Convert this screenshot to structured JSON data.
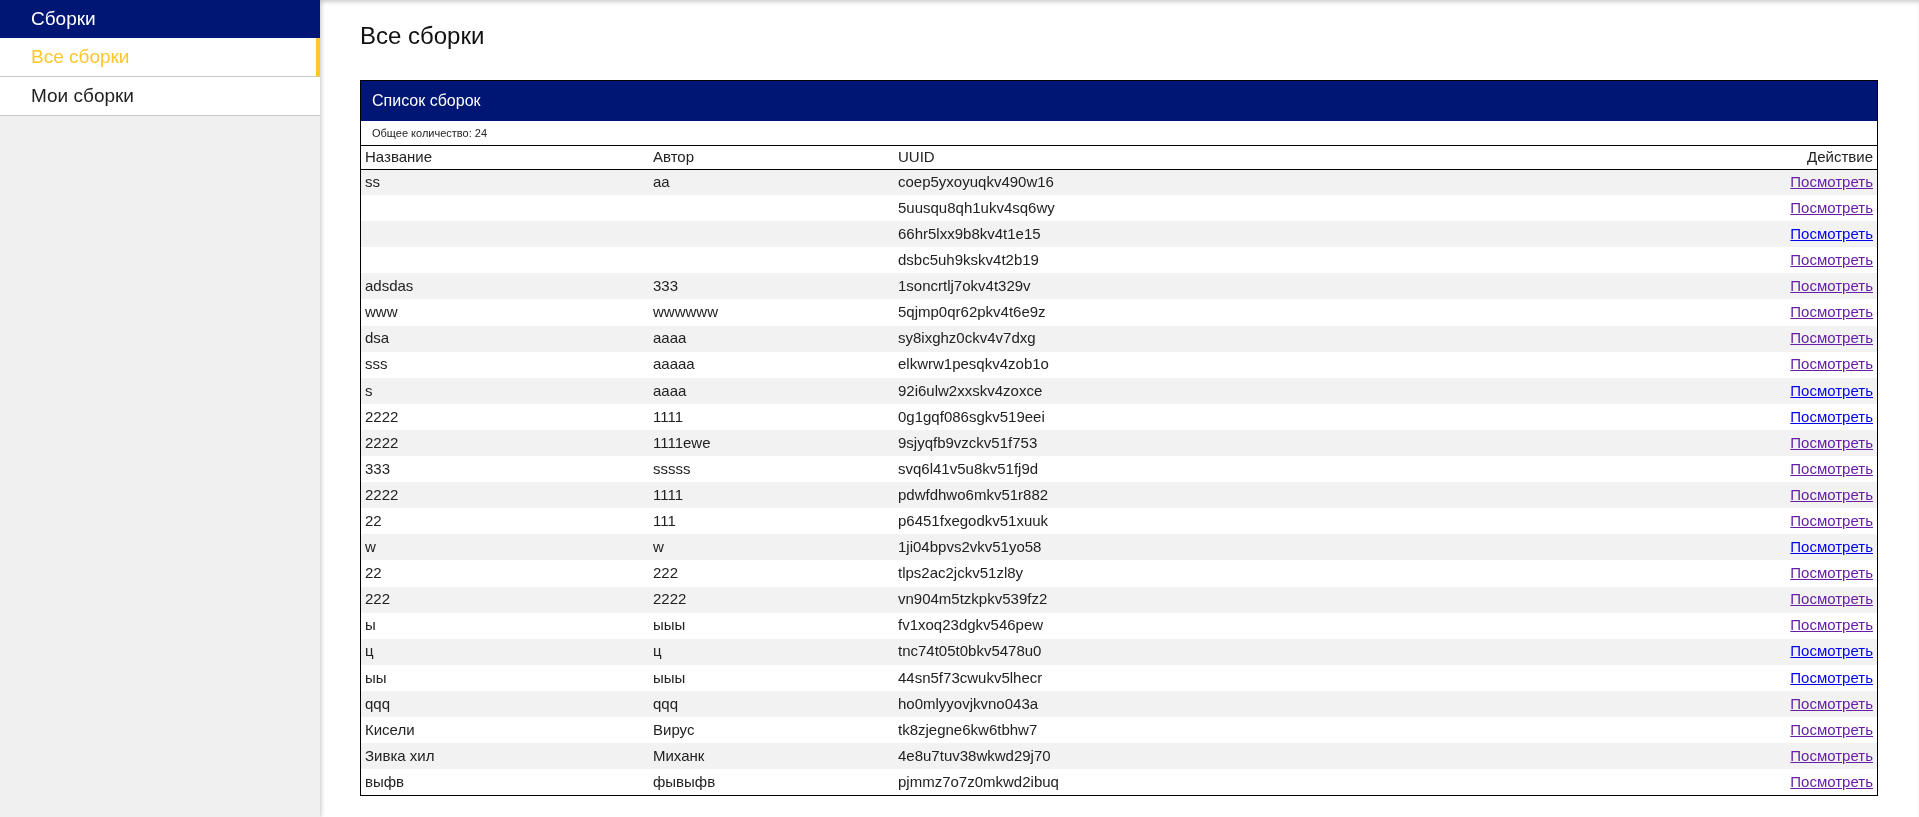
{
  "sidebar": {
    "title": "Сборки",
    "items": [
      {
        "label": "Все сборки",
        "selected": true
      },
      {
        "label": "Мои сборки",
        "selected": false
      }
    ]
  },
  "page_title": "Все сборки",
  "panel": {
    "title": "Список сборок",
    "total": "Общее количество: 24",
    "columns": [
      "Название",
      "Автор",
      "UUID",
      "Действие"
    ],
    "rows": [
      {
        "name": "ss",
        "author": "aa",
        "uuid": "coep5yxoyuqkv490w16",
        "action": "Посмотреть",
        "visited": true
      },
      {
        "name": "",
        "author": "",
        "uuid": "5uusqu8qh1ukv4sq6wy",
        "action": "Посмотреть",
        "visited": true
      },
      {
        "name": "",
        "author": "",
        "uuid": "66hr5lxx9b8kv4t1e15",
        "action": "Посмотреть",
        "visited": false
      },
      {
        "name": "",
        "author": "",
        "uuid": "dsbc5uh9kskv4t2b19",
        "action": "Посмотреть",
        "visited": true
      },
      {
        "name": "adsdas",
        "author": "333",
        "uuid": "1soncrtlj7okv4t329v",
        "action": "Посмотреть",
        "visited": true
      },
      {
        "name": "www",
        "author": "wwwwww",
        "uuid": "5qjmp0qr62pkv4t6e9z",
        "action": "Посмотреть",
        "visited": true
      },
      {
        "name": "dsa",
        "author": "aaaa",
        "uuid": "sy8ixghz0ckv4v7dxg",
        "action": "Посмотреть",
        "visited": true
      },
      {
        "name": "sss",
        "author": "aaaaa",
        "uuid": "elkwrw1pesqkv4zob1o",
        "action": "Посмотреть",
        "visited": true
      },
      {
        "name": "s",
        "author": "aaaa",
        "uuid": "92i6ulw2xxskv4zoxce",
        "action": "Посмотреть",
        "visited": false
      },
      {
        "name": "2222",
        "author": "1111",
        "uuid": "0g1gqf086sgkv519eei",
        "action": "Посмотреть",
        "visited": false
      },
      {
        "name": "2222",
        "author": "1111ewe",
        "uuid": "9sjyqfb9vzckv51f753",
        "action": "Посмотреть",
        "visited": true
      },
      {
        "name": "333",
        "author": "sssss",
        "uuid": "svq6l41v5u8kv51fj9d",
        "action": "Посмотреть",
        "visited": true
      },
      {
        "name": "2222",
        "author": "1111",
        "uuid": "pdwfdhwo6mkv51r882",
        "action": "Посмотреть",
        "visited": true
      },
      {
        "name": "22",
        "author": "111",
        "uuid": "p6451fxegodkv51xuuk",
        "action": "Посмотреть",
        "visited": true
      },
      {
        "name": "w",
        "author": "w",
        "uuid": "1ji04bpvs2vkv51yo58",
        "action": "Посмотреть",
        "visited": false
      },
      {
        "name": "22",
        "author": "222",
        "uuid": "tlps2ac2jckv51zl8y",
        "action": "Посмотреть",
        "visited": true
      },
      {
        "name": "222",
        "author": "2222",
        "uuid": "vn904m5tzkpkv539fz2",
        "action": "Посмотреть",
        "visited": true
      },
      {
        "name": "ы",
        "author": "ыыы",
        "uuid": "fv1xoq23dgkv546pew",
        "action": "Посмотреть",
        "visited": true
      },
      {
        "name": "ц",
        "author": "ц",
        "uuid": "tnc74t05t0bkv5478u0",
        "action": "Посмотреть",
        "visited": false
      },
      {
        "name": "ыы",
        "author": "ыыы",
        "uuid": "44sn5f73cwukv5lhecr",
        "action": "Посмотреть",
        "visited": false
      },
      {
        "name": "qqq",
        "author": "qqq",
        "uuid": "ho0mlyyovjkvno043a",
        "action": "Посмотреть",
        "visited": true
      },
      {
        "name": "Кисели",
        "author": "Вирус",
        "uuid": "tk8zjegne6kw6tbhw7",
        "action": "Посмотреть",
        "visited": true
      },
      {
        "name": "Зивка хил",
        "author": "Миханк",
        "uuid": "4e8u7tuv38wkwd29j70",
        "action": "Посмотреть",
        "visited": true
      },
      {
        "name": "выфв",
        "author": "фывыфв",
        "uuid": "pjmmz7o7z0mkwd2ibuq",
        "action": "Посмотреть",
        "visited": true
      }
    ]
  }
}
